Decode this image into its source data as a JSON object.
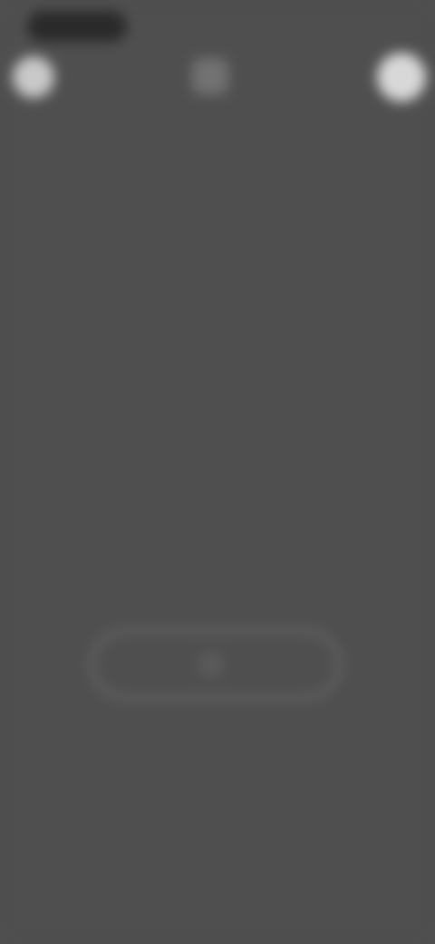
{
  "status_bar": {
    "time": ""
  },
  "header": {
    "title": ""
  },
  "empty_state": {
    "message": ""
  },
  "action": {
    "label": ""
  },
  "icons": {
    "left": "avatar-icon",
    "center": "app-icon",
    "right": "profile-avatar-icon",
    "button": "square-icon"
  },
  "colors": {
    "background": "#4f4f4f",
    "title": "#dcdcdc",
    "muted_text": "#8a8a8a",
    "button_border": "#767676"
  }
}
